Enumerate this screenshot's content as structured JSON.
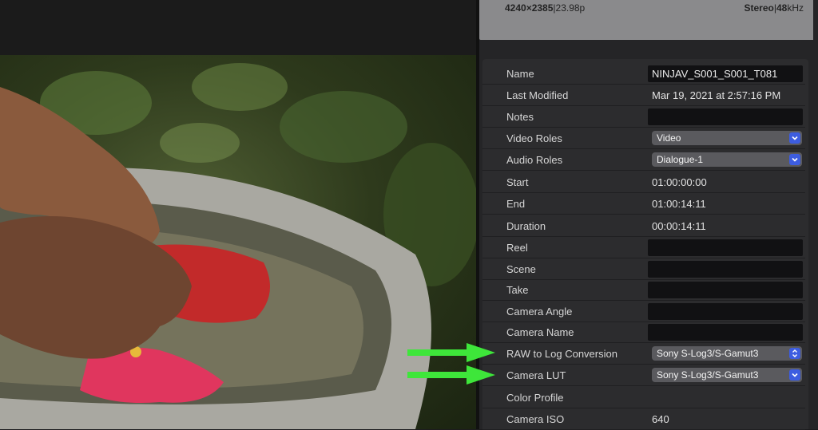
{
  "info_header": {
    "resolution": "4240×2385",
    "frame_rate": "23.98p",
    "audio_channels": "Stereo",
    "audio_rate": "48",
    "audio_rate_unit": "kHz"
  },
  "properties": {
    "name": {
      "label": "Name",
      "value": "NINJAV_S001_S001_T081"
    },
    "last_modified": {
      "label": "Last Modified",
      "value": "Mar 19, 2021 at 2:57:16 PM"
    },
    "notes": {
      "label": "Notes",
      "value": ""
    },
    "video_roles": {
      "label": "Video Roles",
      "value": "Video"
    },
    "audio_roles": {
      "label": "Audio Roles",
      "value": "Dialogue-1"
    },
    "start": {
      "label": "Start",
      "value": "01:00:00:00"
    },
    "end": {
      "label": "End",
      "value": "01:00:14:11"
    },
    "duration": {
      "label": "Duration",
      "value": "00:00:14:11"
    },
    "reel": {
      "label": "Reel",
      "value": ""
    },
    "scene": {
      "label": "Scene",
      "value": ""
    },
    "take": {
      "label": "Take",
      "value": ""
    },
    "camera_angle": {
      "label": "Camera Angle",
      "value": ""
    },
    "camera_name": {
      "label": "Camera Name",
      "value": ""
    },
    "raw_to_log": {
      "label": "RAW to Log Conversion",
      "value": "Sony S-Log3/S-Gamut3"
    },
    "camera_lut": {
      "label": "Camera LUT",
      "value": "Sony S-Log3/S-Gamut3"
    },
    "color_profile": {
      "label": "Color Profile",
      "value": ""
    },
    "camera_iso": {
      "label": "Camera ISO",
      "value": "640"
    }
  },
  "colors": {
    "annotation_arrow": "#3ee63a",
    "popup_button": "#3d5de0"
  }
}
